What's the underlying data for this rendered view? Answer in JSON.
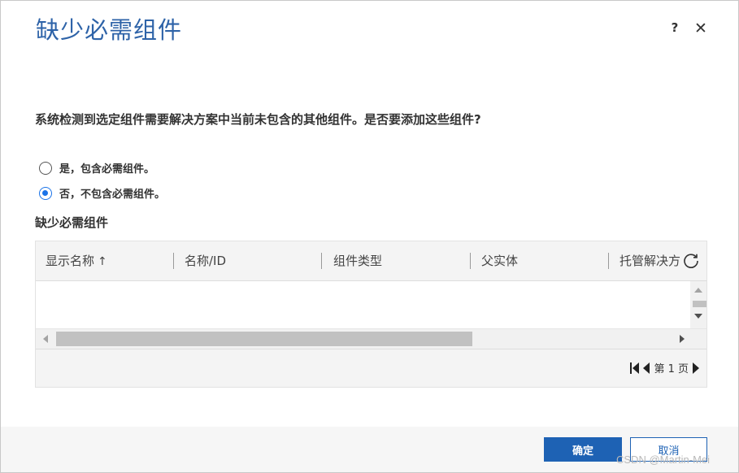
{
  "dialog": {
    "title": "缺少必需组件",
    "help_label": "?",
    "close_label": "✕"
  },
  "question": "系统检测到选定组件需要解决方案中当前未包含的其他组件。是否要添加这些组件?",
  "options": [
    {
      "label": "是，包含必需组件。",
      "checked": false
    },
    {
      "label": "否，不包含必需组件。",
      "checked": true
    }
  ],
  "section_title": "缺少必需组件",
  "grid": {
    "columns": [
      {
        "label": "显示名称",
        "sort": "↑"
      },
      {
        "label": "名称/ID"
      },
      {
        "label": "组件类型"
      },
      {
        "label": "父实体"
      },
      {
        "label": "托管解决方"
      }
    ],
    "rows": []
  },
  "pager": {
    "page_label": "第 1 页"
  },
  "buttons": {
    "ok": "确定",
    "cancel": "取消"
  },
  "watermark": "CSDN @Martin-Mei",
  "colors": {
    "title": "#2e63a8",
    "primary": "#1e62b4",
    "radio_accent": "#1a73e8"
  }
}
